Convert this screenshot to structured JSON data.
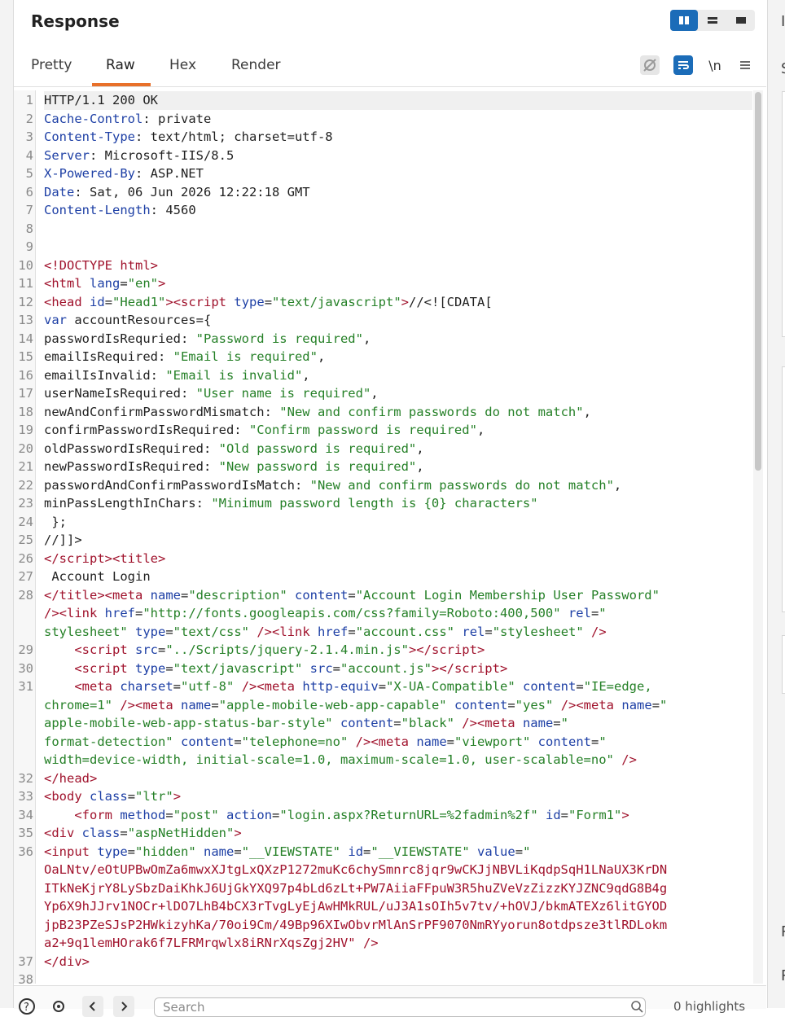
{
  "panel": {
    "title": "Response",
    "tabs": [
      {
        "label": "Pretty"
      },
      {
        "label": "Raw"
      },
      {
        "label": "Hex"
      },
      {
        "label": "Render"
      }
    ],
    "active_tab": "Raw",
    "newline_toggle_label": "\\n"
  },
  "editor": {
    "lines": [
      {
        "n": "1",
        "html": "<span class='k'>HTTP/1.1 200 OK</span>"
      },
      {
        "n": "2",
        "html": "<span class='h'>Cache-Control</span>: private"
      },
      {
        "n": "3",
        "html": "<span class='h'>Content-Type</span>: text/html; charset=utf-8"
      },
      {
        "n": "4",
        "html": "<span class='h'>Server</span>: Microsoft-IIS/8.5"
      },
      {
        "n": "5",
        "html": "<span class='h'>X-Powered-By</span>: ASP.NET"
      },
      {
        "n": "6",
        "html": "<span class='h'>Date</span>: Sat, 06 Jun 2026 12:22:18 GMT"
      },
      {
        "n": "7",
        "html": "<span class='h'>Content-Length</span>: 4560"
      },
      {
        "n": "8",
        "html": ""
      },
      {
        "n": "9",
        "html": ""
      },
      {
        "n": "10",
        "html": "<span class='t'>&lt;!DOCTYPE html&gt;</span>"
      },
      {
        "n": "11",
        "html": "<span class='t'>&lt;html</span> <span class='a'>lang</span>=<span class='s'>\"en\"</span><span class='t'>&gt;</span>"
      },
      {
        "n": "12",
        "html": "<span class='t'>&lt;head</span> <span class='a'>id</span>=<span class='s'>\"Head1\"</span><span class='t'>&gt;&lt;script</span> <span class='a'>type</span>=<span class='s'>\"text/javascript\"</span><span class='t'>&gt;</span>//&lt;![CDATA["
      },
      {
        "n": "13",
        "html": "<span class='h'>var</span> accountResources={"
      },
      {
        "n": "14",
        "html": "passwordIsRequried: <span class='v'>\"Password is required\"</span>,"
      },
      {
        "n": "15",
        "html": "emailIsRequired: <span class='v'>\"Email is required\"</span>,"
      },
      {
        "n": "16",
        "html": "emailIsInvalid: <span class='v'>\"Email is invalid\"</span>,"
      },
      {
        "n": "17",
        "html": "userNameIsRequired: <span class='v'>\"User name is required\"</span>,"
      },
      {
        "n": "18",
        "html": "newAndConfirmPasswordMismatch: <span class='v'>\"New and confirm passwords do not match\"</span>,"
      },
      {
        "n": "19",
        "html": "confirmPasswordIsRequired: <span class='v'>\"Confirm password is required\"</span>,"
      },
      {
        "n": "20",
        "html": "oldPasswordIsRequired: <span class='v'>\"Old password is required\"</span>,"
      },
      {
        "n": "21",
        "html": "newPasswordIsRequired: <span class='v'>\"New password is required\"</span>,"
      },
      {
        "n": "22",
        "html": "passwordAndConfirmPasswordIsMatch: <span class='v'>\"New and confirm passwords do not match\"</span>,"
      },
      {
        "n": "23",
        "html": "minPassLengthInChars: <span class='v'>\"Minimum password length is {0} characters\"</span>"
      },
      {
        "n": "24",
        "html": " };"
      },
      {
        "n": "25",
        "html": "//]]&gt;"
      },
      {
        "n": "26",
        "html": "<span class='t'>&lt;/script&gt;&lt;title&gt;</span>"
      },
      {
        "n": "27",
        "html": " Account Login"
      },
      {
        "n": "28",
        "html": "<span class='t'>&lt;/title&gt;&lt;meta</span> <span class='a'>name</span>=<span class='s'>\"description\"</span> <span class='a'>content</span>=<span class='s'>\"Account Login Membership User Password\"</span>"
      },
      {
        "n": "",
        "html": "<span class='t'>/&gt;&lt;link</span> <span class='a'>href</span>=<span class='s'>\"http://fonts.googleapis.com/css?family=Roboto:400,500\"</span> <span class='a'>rel</span>=<span class='s'>\"</span>"
      },
      {
        "n": "",
        "html": "<span class='s'>stylesheet\"</span> <span class='a'>type</span>=<span class='s'>\"text/css\"</span> <span class='t'>/&gt;&lt;link</span> <span class='a'>href</span>=<span class='s'>\"account.css\"</span> <span class='a'>rel</span>=<span class='s'>\"stylesheet\"</span> <span class='t'>/&gt;</span>"
      },
      {
        "n": "29",
        "html": "    <span class='t'>&lt;script</span> <span class='a'>src</span>=<span class='s'>\"../Scripts/jquery-2.1.4.min.js\"</span><span class='t'>&gt;&lt;/script&gt;</span>"
      },
      {
        "n": "30",
        "html": "    <span class='t'>&lt;script</span> <span class='a'>type</span>=<span class='s'>\"text/javascript\"</span> <span class='a'>src</span>=<span class='s'>\"account.js\"</span><span class='t'>&gt;&lt;/script&gt;</span>"
      },
      {
        "n": "31",
        "html": "    <span class='t'>&lt;meta</span> <span class='a'>charset</span>=<span class='s'>\"utf-8\"</span> <span class='t'>/&gt;&lt;meta</span> <span class='a'>http-equiv</span>=<span class='s'>\"X-UA-Compatible\"</span> <span class='a'>content</span>=<span class='s'>\"IE=edge,</span>"
      },
      {
        "n": "",
        "html": "<span class='s'>chrome=1\"</span> <span class='t'>/&gt;&lt;meta</span> <span class='a'>name</span>=<span class='s'>\"apple-mobile-web-app-capable\"</span> <span class='a'>content</span>=<span class='s'>\"yes\"</span> <span class='t'>/&gt;&lt;meta</span> <span class='a'>name</span>=<span class='s'>\"</span>"
      },
      {
        "n": "",
        "html": "<span class='s'>apple-mobile-web-app-status-bar-style\"</span> <span class='a'>content</span>=<span class='s'>\"black\"</span> <span class='t'>/&gt;&lt;meta</span> <span class='a'>name</span>=<span class='s'>\"</span>"
      },
      {
        "n": "",
        "html": "<span class='s'>format-detection\"</span> <span class='a'>content</span>=<span class='s'>\"telephone=no\"</span> <span class='t'>/&gt;&lt;meta</span> <span class='a'>name</span>=<span class='s'>\"viewport\"</span> <span class='a'>content</span>=<span class='s'>\"</span>"
      },
      {
        "n": "",
        "html": "<span class='s'>width=device-width, initial-scale=1.0, maximum-scale=1.0, user-scalable=no\"</span> <span class='t'>/&gt;</span>"
      },
      {
        "n": "32",
        "html": "<span class='t'>&lt;/head&gt;</span>"
      },
      {
        "n": "33",
        "html": "<span class='t'>&lt;body</span> <span class='a'>class</span>=<span class='s'>\"ltr\"</span><span class='t'>&gt;</span>"
      },
      {
        "n": "34",
        "html": "    <span class='t'>&lt;form</span> <span class='a'>method</span>=<span class='s'>\"post\"</span> <span class='a'>action</span>=<span class='s'>\"login.aspx?ReturnURL=%2fadmin%2f\"</span> <span class='a'>id</span>=<span class='s'>\"Form1\"</span><span class='t'>&gt;</span>"
      },
      {
        "n": "35",
        "html": "<span class='t'>&lt;div</span> <span class='a'>class</span>=<span class='s'>\"aspNetHidden\"</span><span class='t'>&gt;</span>"
      },
      {
        "n": "36",
        "html": "<span class='t'>&lt;input</span> <span class='a'>type</span>=<span class='s'>\"hidden\"</span> <span class='a'>name</span>=<span class='s'>\"__VIEWSTATE\"</span> <span class='a'>id</span>=<span class='s'>\"__VIEWSTATE\"</span> <span class='a'>value</span>=<span class='s'>\"</span>"
      },
      {
        "n": "",
        "html": "<span class='r'>OaLNtv/eOtUPBwOmZa6mwxXJtgLxQXzP1272muKc6chySmnrc8jqr9wCKJjNBVLiKqdpSqH1LNaUX3KrDN</span>"
      },
      {
        "n": "",
        "html": "<span class='r'>ITkNeKjrY8LySbzDaiKhkJ6UjGkYXQ97p4bLd6zLt+PW7AiiaFFpuW3R5huZVeVzZizzKYJZNC9qdG8B4g</span>"
      },
      {
        "n": "",
        "html": "<span class='r'>Yp6X9hJJrv1NOCr+lDO7LhB4bCX3rTvgLyEjAwHMkRUL/uJ3A1sOIh5v7tv/+hOVJ/bkmATEXz6litGYOD</span>"
      },
      {
        "n": "",
        "html": "<span class='r'>jpB23PZeSJsP2HWkizyhKa/70oi9Cm/49Bp96XIwObvrMlAnSrPF9070NmRYyorun8otdpsze3tlRDLokm</span>"
      },
      {
        "n": "",
        "html": "<span class='r'>a2+9q1lemHOrak6f7LFRMrqwlx8iRNrXqsZgj2HV\"</span> <span class='t'>/&gt;</span>"
      },
      {
        "n": "37",
        "html": "<span class='t'>&lt;/div&gt;</span>"
      },
      {
        "n": "38",
        "html": ""
      }
    ]
  },
  "search": {
    "placeholder": "Search",
    "highlights_label": "0 highlights"
  },
  "colors": {
    "accent": "#e8702a",
    "toggle_active": "#1b6cb8",
    "header_name": "#1d3fa5",
    "string_value": "#258027",
    "tag": "#a0122c"
  },
  "icons": [
    "layout-split-icon",
    "layout-horizontal-icon",
    "layout-single-icon",
    "hide-nonprinting-icon",
    "wrap-lines-icon",
    "newline-icon",
    "menu-icon",
    "help-icon",
    "settings-icon",
    "back-arrow-icon",
    "forward-arrow-icon",
    "search-icon"
  ]
}
